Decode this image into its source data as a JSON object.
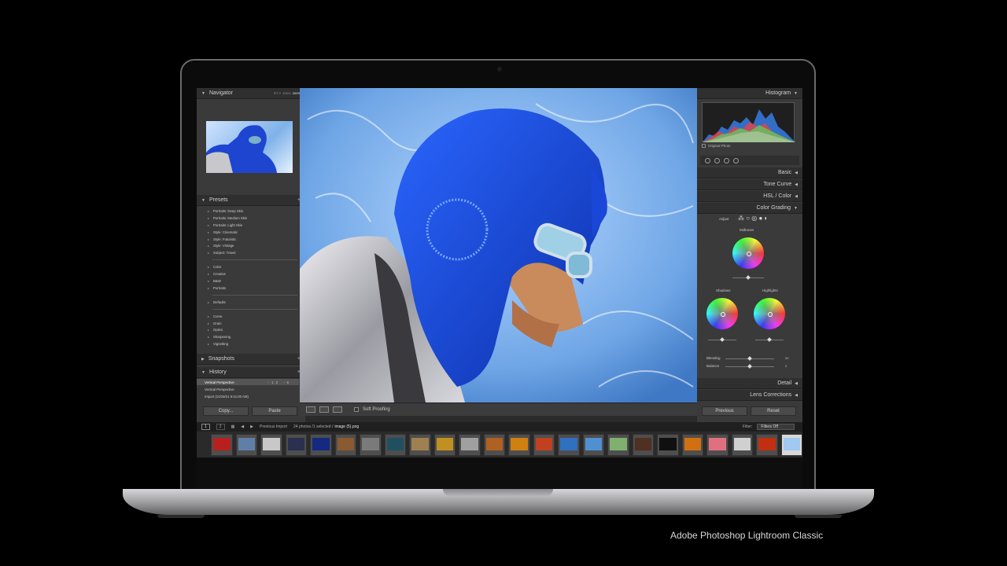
{
  "caption": "Adobe Photoshop Lightroom Classic",
  "navigator": {
    "title": "Navigator",
    "zoom_options": [
      "FIT ≡",
      "100%",
      "200%"
    ]
  },
  "presets": {
    "title": "Presets",
    "group1": [
      "Portraits: Deep Skin",
      "Portraits: Medium Skin",
      "Portraits: Light Skin",
      "Style: Cinematic",
      "Style: Futuristic",
      "Style: Vintage",
      "Subject: Travel"
    ],
    "group2": [
      "Color",
      "Creative",
      "B&W",
      "Portraits"
    ],
    "group3": [
      "Defaults"
    ],
    "group4": [
      "Curve",
      "Grain",
      "Optics",
      "Sharpening",
      "Vignetting"
    ]
  },
  "snapshots": {
    "title": "Snapshots"
  },
  "history": {
    "title": "History",
    "items": [
      {
        "label": "Vertical Perspective",
        "nums": "-12  -6"
      },
      {
        "label": "Vertical Perspective",
        "nums": ""
      },
      {
        "label": "Import (10/19/21 9:41:00 AM)",
        "nums": ""
      }
    ]
  },
  "left_buttons": {
    "copy": "Copy...",
    "paste": "Paste"
  },
  "toolbar": {
    "soft_proofing": "Soft Proofing"
  },
  "right_panel": {
    "histogram_title": "Histogram",
    "original_photo": "Original Photo",
    "sections": [
      "Basic",
      "Tone Curve",
      "HSL / Color",
      "Color Grading"
    ],
    "adjust_label": "Adjust",
    "midtones": "Midtones",
    "shadows": "Shadows",
    "highlights": "Highlights",
    "blending": "Blending",
    "balance": "Balance",
    "blending_value": "50",
    "balance_value": "0",
    "detail": "Detail",
    "lens_corrections": "Lens Corrections",
    "previous": "Previous",
    "reset": "Reset"
  },
  "filmstrip": {
    "page1": "1",
    "page2": "2",
    "source": "Previous Import",
    "count": "24 photos /1 selected /",
    "selected_file": "image (5).png",
    "filter_label": "Filter:",
    "filter_value": "Filters Off"
  },
  "thumb_colors": [
    "#b82020",
    "#5f7fa8",
    "#c8c8c8",
    "#2a3050",
    "#142a80",
    "#8a5a30",
    "#7a7a7a",
    "#205060",
    "#a08050",
    "#c09020",
    "#a0a0a0",
    "#b06020",
    "#d08010",
    "#c04020",
    "#3070c0",
    "#5090d0",
    "#80b070",
    "#503020",
    "#101010",
    "#d07010",
    "#e07080",
    "#d0d0d0",
    "#c03010",
    "#a0c8f0"
  ]
}
